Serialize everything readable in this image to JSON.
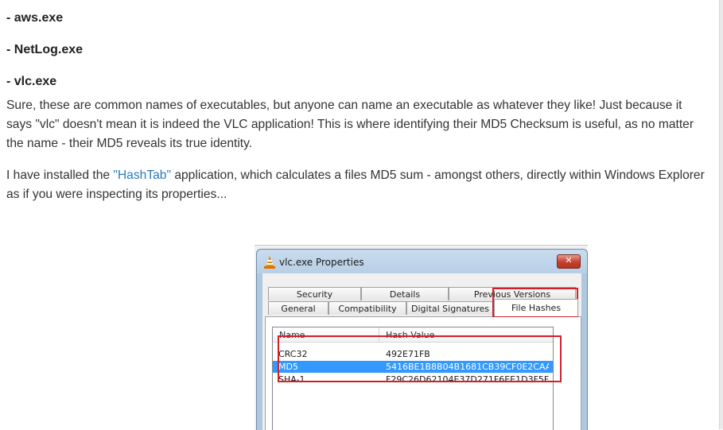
{
  "article": {
    "exe_items": [
      "- aws.exe",
      "- NetLog.exe",
      "- vlc.exe"
    ],
    "paragraph1": "Sure, these are common names of executables, but anyone can name an executable as whatever they like! Just because it says \"vlc\" doesn't mean it is indeed the VLC application! This is where identifying their MD5 Checksum is useful, as no matter the name - their MD5 reveals its true identity.",
    "paragraph2_before": "I have installed the ",
    "paragraph2_link": "\"HashTab\"",
    "paragraph2_after": " application, which calculates a files MD5 sum - amongst others, directly within Windows Explorer as if you were inspecting its properties..."
  },
  "dialog": {
    "title": "vlc.exe Properties",
    "close_label": "✕",
    "tabs_back": [
      "Security",
      "Details",
      "Previous Versions"
    ],
    "tabs_front": [
      "General",
      "Compatibility",
      "Digital Signatures",
      "File Hashes"
    ],
    "active_tab": "File Hashes",
    "columns": [
      "Name",
      "Hash Value"
    ],
    "rows": [
      {
        "name": "CRC32",
        "hash": "492E71FB"
      },
      {
        "name": "MD5",
        "hash": "5416BE1B8B04B1681CB39CF0E2CAA...",
        "selected": true
      },
      {
        "name": "SHA-1",
        "hash": "F29C26D62104E37D271F6EE1D3F5F..."
      }
    ]
  },
  "colors": {
    "link": "#2a7ab8",
    "highlight_box": "#d0202a",
    "selection": "#3399ff"
  },
  "icons": {
    "dialog_icon": "vlc-cone-icon",
    "close": "close-icon"
  }
}
